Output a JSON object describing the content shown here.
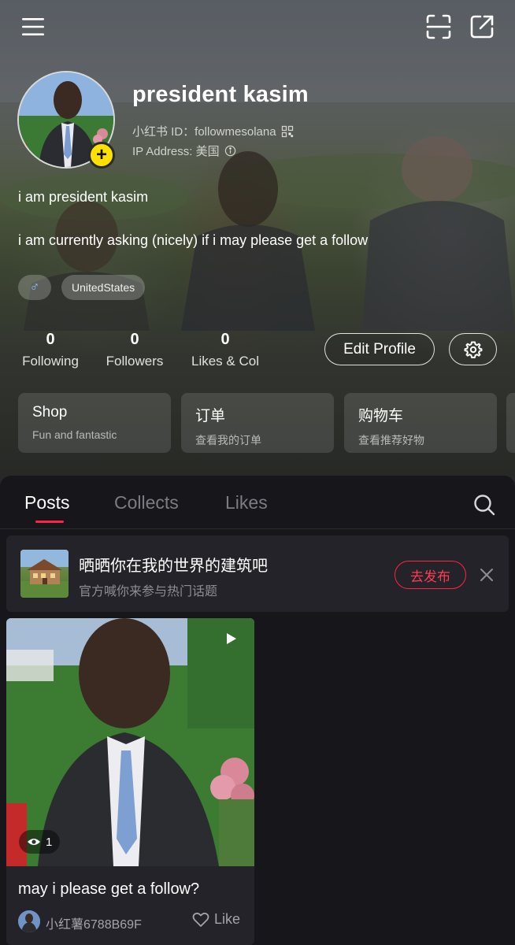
{
  "header": {
    "menu_icon": "hamburger-menu-icon",
    "scan_icon": "scan-icon",
    "share_icon": "share-icon"
  },
  "profile": {
    "username": "president kasim",
    "id_line": "小红书 ID：followmesolana",
    "ip_line": "IP Address: 美国",
    "bio_line1": "i am president kasim",
    "bio_line2": "i am currently asking (nicely) if i may please get a follow",
    "tags": {
      "gender": "♂",
      "location": "UnitedStates"
    }
  },
  "stats": {
    "following": {
      "count": "0",
      "label": "Following"
    },
    "followers": {
      "count": "0",
      "label": "Followers"
    },
    "likes": {
      "count": "0",
      "label": "Likes & Col"
    }
  },
  "actions": {
    "edit_profile": "Edit Profile"
  },
  "cards": [
    {
      "title": "Shop",
      "subtitle": "Fun and fantastic"
    },
    {
      "title": "订单",
      "subtitle": "查看我的订单"
    },
    {
      "title": "购物车",
      "subtitle": "查看推荐好物"
    }
  ],
  "tabs": [
    "Posts",
    "Collects",
    "Likes"
  ],
  "banner": {
    "title": "晒晒你在我的世界的建筑吧",
    "subtitle": "官方喊你来参与热门话题",
    "button": "去发布"
  },
  "post": {
    "views": "1",
    "title": "may i please get a follow?",
    "author": "小红薯6788B69F",
    "like_label": "Like"
  },
  "colors": {
    "accent": "#ff2442",
    "badge": "#ffe100",
    "background": "#16161b"
  }
}
